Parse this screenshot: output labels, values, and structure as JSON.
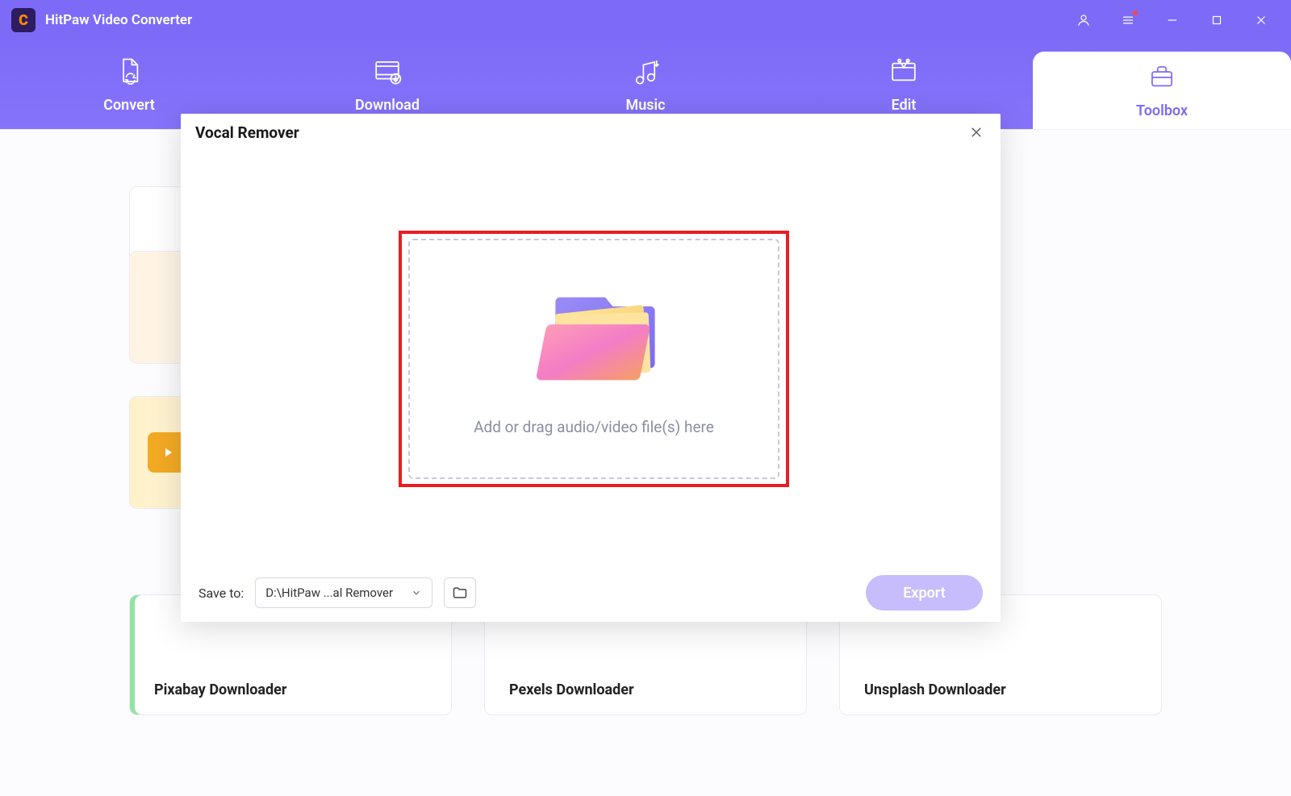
{
  "app": {
    "title": "HitPaw Video Converter",
    "logo_letter": "C"
  },
  "nav": {
    "items": [
      {
        "label": "Convert"
      },
      {
        "label": "Download"
      },
      {
        "label": "Music"
      },
      {
        "label": "Edit"
      },
      {
        "label": "Toolbox"
      }
    ],
    "active_index": 4
  },
  "modal": {
    "title": "Vocal Remover",
    "drop_text": "Add or drag audio/video file(s) here",
    "save_to_label": "Save to:",
    "save_to_value": "D:\\HitPaw ...al Remover",
    "export_label": "Export"
  },
  "downloaders": [
    {
      "label": "Pixabay Downloader"
    },
    {
      "label": "Pexels Downloader"
    },
    {
      "label": "Unsplash Downloader"
    }
  ]
}
